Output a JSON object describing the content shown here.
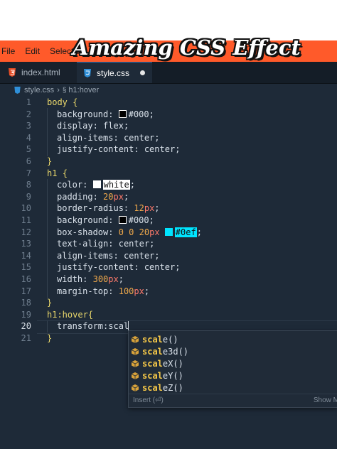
{
  "overlay_title": "Amazing CSS Effect",
  "menu": [
    "File",
    "Edit",
    "Selection"
  ],
  "tabs": [
    {
      "label": "index.html",
      "icon": "html5-icon",
      "active": false
    },
    {
      "label": "style.css",
      "icon": "css3-icon",
      "active": true,
      "modified": true
    }
  ],
  "breadcrumb": {
    "file": "style.css",
    "symbol": "h1:hover"
  },
  "code": {
    "lines": [
      {
        "n": "1"
      },
      {
        "n": "2"
      },
      {
        "n": "3"
      },
      {
        "n": "4"
      },
      {
        "n": "5"
      },
      {
        "n": "6"
      },
      {
        "n": "7"
      },
      {
        "n": "8"
      },
      {
        "n": "9"
      },
      {
        "n": "10"
      },
      {
        "n": "11"
      },
      {
        "n": "12"
      },
      {
        "n": "13"
      },
      {
        "n": "14"
      },
      {
        "n": "15"
      },
      {
        "n": "16"
      },
      {
        "n": "17"
      },
      {
        "n": "18"
      },
      {
        "n": "19"
      },
      {
        "n": "20"
      },
      {
        "n": "21"
      }
    ],
    "t": {
      "body": "body",
      "ob": "{",
      "cb": "}",
      "background": "background:",
      "c000": "#000",
      "semi": ";",
      "display": "display:",
      "flex": "flex",
      "align_items": "align-items:",
      "center": "center",
      "justify_content": "justify-content:",
      "h1": "h1",
      "color": "color:",
      "white": "white",
      "padding": "padding:",
      "n20": "20",
      "px": "px",
      "border_radius": "border-radius:",
      "n12": "12",
      "box_shadow": "box-shadow:",
      "zeros": "0 0",
      "c0ef": "#0ef",
      "text_align": "text-align:",
      "width": "width:",
      "n300": "300",
      "margin_top": "margin-top:",
      "n100": "100",
      "h1hover": "h1:hover",
      "obr": "{",
      "transform": "transform:scal"
    }
  },
  "suggestions": {
    "typed": "scal",
    "items": [
      {
        "match": "scal",
        "rest": "e()"
      },
      {
        "match": "scal",
        "rest": "e3d()"
      },
      {
        "match": "scal",
        "rest": "eX()"
      },
      {
        "match": "scal",
        "rest": "eY()"
      },
      {
        "match": "scal",
        "rest": "eZ()"
      }
    ],
    "footer_left": "Insert (⏎)",
    "footer_right": "Show M"
  },
  "colors": {
    "menubar": "#ff5a2a",
    "editor_bg": "#1e2a38",
    "selector": "#e9d76b",
    "number": "#f0a94b",
    "unit": "#ff7a6b",
    "swatch_cyan": "#00e5ff"
  }
}
